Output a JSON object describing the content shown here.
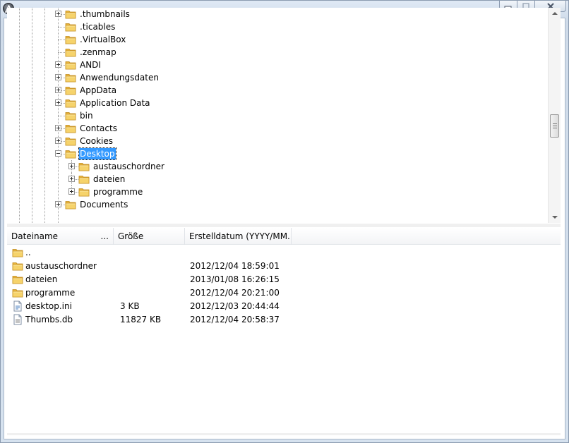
{
  "window": {
    "app_icon": "autoit-logo-icon",
    "buttons": [
      "minimize-icon",
      "maximize-icon",
      "close-icon"
    ]
  },
  "tree": {
    "items": [
      {
        "label": ".thumbnails",
        "level": 1,
        "expandable": true
      },
      {
        "label": ".ticables",
        "level": 1,
        "expandable": false
      },
      {
        "label": ".VirtualBox",
        "level": 1,
        "expandable": false
      },
      {
        "label": ".zenmap",
        "level": 1,
        "expandable": false
      },
      {
        "label": "ANDI",
        "level": 1,
        "expandable": true
      },
      {
        "label": "Anwendungsdaten",
        "level": 1,
        "expandable": true
      },
      {
        "label": "AppData",
        "level": 1,
        "expandable": true
      },
      {
        "label": "Application Data",
        "level": 1,
        "expandable": true
      },
      {
        "label": "bin",
        "level": 1,
        "expandable": false
      },
      {
        "label": "Contacts",
        "level": 1,
        "expandable": true
      },
      {
        "label": "Cookies",
        "level": 1,
        "expandable": true
      },
      {
        "label": "Desktop",
        "level": 1,
        "expandable": true,
        "expanded": true,
        "selected": true
      },
      {
        "label": "austauschordner",
        "level": 2,
        "expandable": true
      },
      {
        "label": "dateien",
        "level": 2,
        "expandable": true
      },
      {
        "label": "programme",
        "level": 2,
        "expandable": true
      },
      {
        "label": "Documents",
        "level": 1,
        "expandable": true
      }
    ]
  },
  "list": {
    "columns": [
      "Dateiname",
      "Größe",
      "Erstelldatum (YYYY/MM..."
    ],
    "rows": [
      {
        "name": "..",
        "size": "",
        "date": "",
        "icon": "folder-icon"
      },
      {
        "name": "austauschordner",
        "size": "",
        "date": "2012/12/04 18:59:01",
        "icon": "folder-icon"
      },
      {
        "name": "dateien",
        "size": "",
        "date": "2013/01/08 16:26:15",
        "icon": "folder-icon"
      },
      {
        "name": "programme",
        "size": "",
        "date": "2012/12/04 20:21:00",
        "icon": "folder-icon"
      },
      {
        "name": "desktop.ini",
        "size": "3 KB",
        "date": "2012/12/03 20:44:44",
        "icon": "settings-file-icon"
      },
      {
        "name": "Thumbs.db",
        "size": "11827 KB",
        "date": "2012/12/04 20:58:37",
        "icon": "file-icon"
      }
    ]
  },
  "colors": {
    "selection": "#3399ff",
    "folder": "#f2c94c"
  }
}
